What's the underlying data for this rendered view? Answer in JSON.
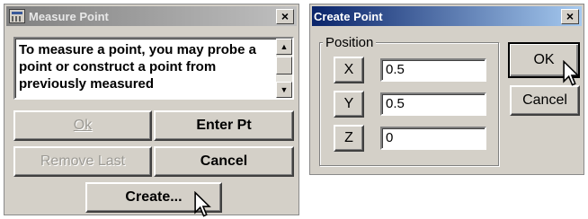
{
  "measure_dialog": {
    "title": "Measure Point",
    "close": "×",
    "message": "To measure a point, you may probe a point or construct a point from previously measured",
    "scroll_up": "▲",
    "scroll_down": "▼",
    "buttons": {
      "ok": "Ok",
      "enter_pt": "Enter Pt",
      "remove_last": "Remove Last",
      "cancel": "Cancel",
      "create": "Create..."
    }
  },
  "create_dialog": {
    "title": "Create Point",
    "close": "×",
    "group_label": "Position",
    "fields": [
      {
        "axis": "X",
        "value": "0.5"
      },
      {
        "axis": "Y",
        "value": "0.5"
      },
      {
        "axis": "Z",
        "value": "0"
      }
    ],
    "buttons": {
      "ok": "OK",
      "cancel": "Cancel"
    }
  },
  "colors": {
    "face": "#d4d0c8",
    "active_title": "#0a246a",
    "inactive_title": "#808080"
  }
}
